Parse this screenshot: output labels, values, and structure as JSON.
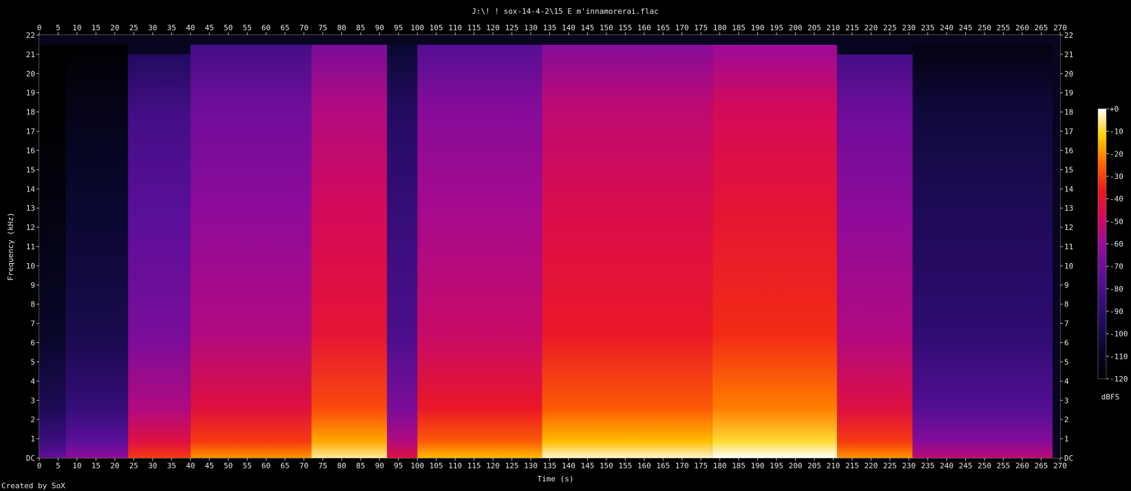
{
  "chart_data": {
    "type": "heatmap",
    "title": "J:\\! ! sox-14-4-2\\15 E m'innamorerai.flac",
    "xlabel": "Time (s)",
    "ylabel": "Frequency (kHz)",
    "footer": "Created by SoX",
    "xlim": [
      0,
      270
    ],
    "ylim": [
      0,
      22
    ],
    "x_ticks": [
      "0",
      "5",
      "10",
      "15",
      "20",
      "25",
      "30",
      "35",
      "40",
      "45",
      "50",
      "55",
      "60",
      "65",
      "70",
      "75",
      "80",
      "85",
      "90",
      "95",
      "100",
      "105",
      "110",
      "115",
      "120",
      "125",
      "130",
      "135",
      "140",
      "145",
      "150",
      "155",
      "160",
      "165",
      "170",
      "175",
      "180",
      "185",
      "190",
      "195",
      "200",
      "205",
      "210",
      "215",
      "220",
      "225",
      "230",
      "235",
      "240",
      "245",
      "250",
      "255",
      "260",
      "265",
      "270"
    ],
    "y_ticks": [
      "DC",
      "1",
      "2",
      "3",
      "4",
      "5",
      "6",
      "7",
      "8",
      "9",
      "10",
      "11",
      "12",
      "13",
      "14",
      "15",
      "16",
      "17",
      "18",
      "19",
      "20",
      "21",
      "22"
    ],
    "colorbar": {
      "label": "dBFS",
      "range": [
        -120,
        0
      ],
      "ticks": [
        "+0",
        "-10",
        "-20",
        "-30",
        "-40",
        "-50",
        "-60",
        "-70",
        "-80",
        "-90",
        "-100",
        "-110",
        "-120"
      ]
    },
    "segments": [
      {
        "t0": 0,
        "t1": 7,
        "bandwidth_khz": 21.5,
        "level": 0.18
      },
      {
        "t0": 7,
        "t1": 23.5,
        "bandwidth_khz": 21.5,
        "level": 0.26
      },
      {
        "t0": 23.5,
        "t1": 40,
        "bandwidth_khz": 21,
        "level": 0.52
      },
      {
        "t0": 40,
        "t1": 72,
        "bandwidth_khz": 21.5,
        "level": 0.62
      },
      {
        "t0": 72,
        "t1": 92,
        "bandwidth_khz": 21.5,
        "level": 0.74
      },
      {
        "t0": 92,
        "t1": 100,
        "bandwidth_khz": 21.5,
        "level": 0.42
      },
      {
        "t0": 100,
        "t1": 133,
        "bandwidth_khz": 21.5,
        "level": 0.66
      },
      {
        "t0": 133,
        "t1": 178,
        "bandwidth_khz": 21.5,
        "level": 0.76
      },
      {
        "t0": 178,
        "t1": 211,
        "bandwidth_khz": 21.5,
        "level": 0.8
      },
      {
        "t0": 211,
        "t1": 231,
        "bandwidth_khz": 21,
        "level": 0.62
      },
      {
        "t0": 231,
        "t1": 268,
        "bandwidth_khz": 21.5,
        "level": 0.34
      }
    ]
  }
}
